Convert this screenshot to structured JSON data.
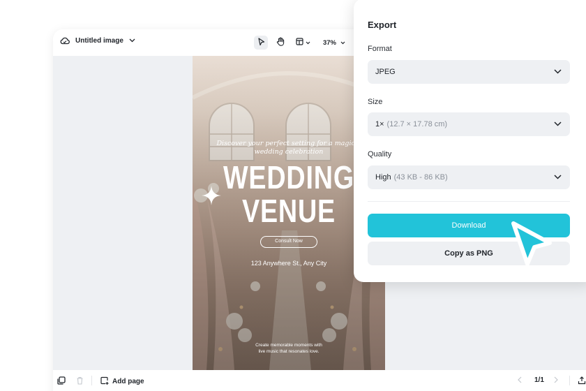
{
  "editor": {
    "doc_title": "Untitled image",
    "zoom": "37%",
    "add_page_label": "Add page",
    "page_indicator": "1/1"
  },
  "poster": {
    "discover_text_line1": "Discover your perfect setting for a magical",
    "discover_text_line2": "wedding celebration",
    "title_line1": "WEDDING",
    "title_line2": "VENUE",
    "consult_button": "Consult Now",
    "address": "123 Anywhere St., Any City",
    "tagline_line1": "Create memorable moments with",
    "tagline_line2": "live music that resonates love."
  },
  "export_panel": {
    "title": "Export",
    "format_label": "Format",
    "format_value": "JPEG",
    "size_label": "Size",
    "size_value": "1×",
    "size_detail": "(12.7 × 17.78 cm)",
    "quality_label": "Quality",
    "quality_value": "High",
    "quality_detail": "(43 KB - 86 KB)",
    "download_label": "Download",
    "copy_label": "Copy as PNG"
  },
  "colors": {
    "accent": "#22c3d9",
    "canvas_bg": "#eef0f3",
    "select_bg": "#eef0f3"
  },
  "icons": [
    "cloud-icon",
    "chevron-down-icon",
    "pointer-icon",
    "hand-icon",
    "layout-icon",
    "layers-icon",
    "trash-icon",
    "add-page-icon",
    "chevron-left-icon",
    "chevron-right-icon",
    "sparkle-icon",
    "cursor-arrow-icon"
  ]
}
